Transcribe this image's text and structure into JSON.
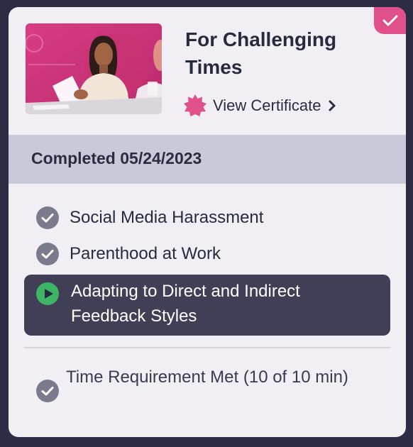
{
  "course": {
    "title": "For Challenging Times",
    "certificate_link": "View Certificate",
    "completed_text": "Completed 05/24/2023"
  },
  "modules": [
    {
      "label": "Social Media Harassment",
      "status": "completed",
      "icon": "check-circle-icon"
    },
    {
      "label": "Parenthood at Work",
      "status": "completed",
      "icon": "check-circle-icon"
    },
    {
      "label": "Adapting to Direct and Indirect Feedback Styles",
      "status": "current",
      "icon": "play-circle-icon"
    }
  ],
  "time_requirement": {
    "label": "Time Requirement Met (10 of 10 min)",
    "icon": "check-circle-icon"
  },
  "colors": {
    "accent_pink": "#e0508a",
    "status_bar": "#c9cad9",
    "active_module_bg": "#403f56",
    "play_green": "#3db565",
    "check_gray": "#7b7b8e"
  }
}
